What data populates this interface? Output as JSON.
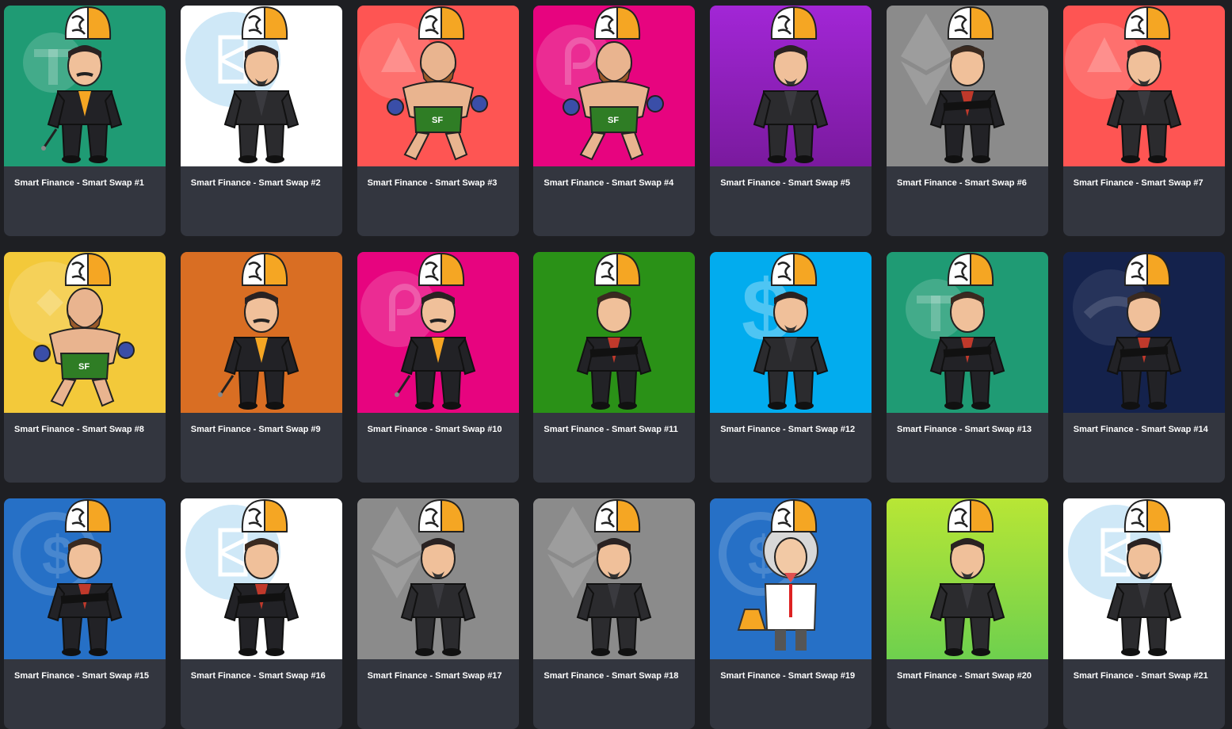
{
  "gallery": {
    "cards": [
      {
        "title": "Smart Finance - Smart Swap #1",
        "bg": "#1f9b74",
        "grad": null,
        "coin": "tether",
        "character": "spy"
      },
      {
        "title": "Smart Finance - Smart Swap #2",
        "bg": "#ffffff",
        "grad": null,
        "coin": "fantom",
        "character": "stark"
      },
      {
        "title": "Smart Finance - Smart Swap #3",
        "bg": "#fe5553",
        "grad": null,
        "coin": "avalanche",
        "character": "fighter"
      },
      {
        "title": "Smart Finance - Smart Swap #4",
        "bg": "#e7047f",
        "grad": null,
        "coin": "polkadot",
        "character": "fighter"
      },
      {
        "title": "Smart Finance - Smart Swap #5",
        "bg": "#a226d6",
        "grad": "#7a1a9e",
        "coin": "none",
        "character": "stark"
      },
      {
        "title": "Smart Finance - Smart Swap #6",
        "bg": "#8b8b8b",
        "grad": null,
        "coin": "ethereum",
        "character": "musk"
      },
      {
        "title": "Smart Finance - Smart Swap #7",
        "bg": "#fe5553",
        "grad": null,
        "coin": "avalanche",
        "character": "stark"
      },
      {
        "title": "Smart Finance - Smart Swap #8",
        "bg": "#f3c93a",
        "grad": null,
        "coin": "binance",
        "character": "fighter"
      },
      {
        "title": "Smart Finance - Smart Swap #9",
        "bg": "#d96e23",
        "grad": null,
        "coin": "none",
        "character": "spy"
      },
      {
        "title": "Smart Finance - Smart Swap #10",
        "bg": "#e7047f",
        "grad": null,
        "coin": "polkadot",
        "character": "spy"
      },
      {
        "title": "Smart Finance - Smart Swap #11",
        "bg": "#2a9117",
        "grad": null,
        "coin": "none",
        "character": "musk"
      },
      {
        "title": "Smart Finance - Smart Swap #12",
        "bg": "#02acee",
        "grad": null,
        "coin": "dollar",
        "character": "stark"
      },
      {
        "title": "Smart Finance - Smart Swap #13",
        "bg": "#1f9b74",
        "grad": null,
        "coin": "tether",
        "character": "musk"
      },
      {
        "title": "Smart Finance - Smart Swap #14",
        "bg": "#14224c",
        "grad": null,
        "coin": "terra",
        "character": "musk"
      },
      {
        "title": "Smart Finance - Smart Swap #15",
        "bg": "#2670c6",
        "grad": null,
        "coin": "usdc",
        "character": "musk"
      },
      {
        "title": "Smart Finance - Smart Swap #16",
        "bg": "#ffffff",
        "grad": null,
        "coin": "fantom",
        "character": "musk"
      },
      {
        "title": "Smart Finance - Smart Swap #17",
        "bg": "#8b8b8b",
        "grad": null,
        "coin": "ethereum",
        "character": "stark"
      },
      {
        "title": "Smart Finance - Smart Swap #18",
        "bg": "#8b8b8b",
        "grad": null,
        "coin": "ethereum",
        "character": "stark"
      },
      {
        "title": "Smart Finance - Smart Swap #19",
        "bg": "#2670c6",
        "grad": null,
        "coin": "usdc",
        "character": "einstein"
      },
      {
        "title": "Smart Finance - Smart Swap #20",
        "bg": "#b8e635",
        "grad": "#6ed04e",
        "coin": "none",
        "character": "stark"
      },
      {
        "title": "Smart Finance - Smart Swap #21",
        "bg": "#ffffff",
        "grad": null,
        "coin": "fantom",
        "character": "stark"
      }
    ]
  }
}
